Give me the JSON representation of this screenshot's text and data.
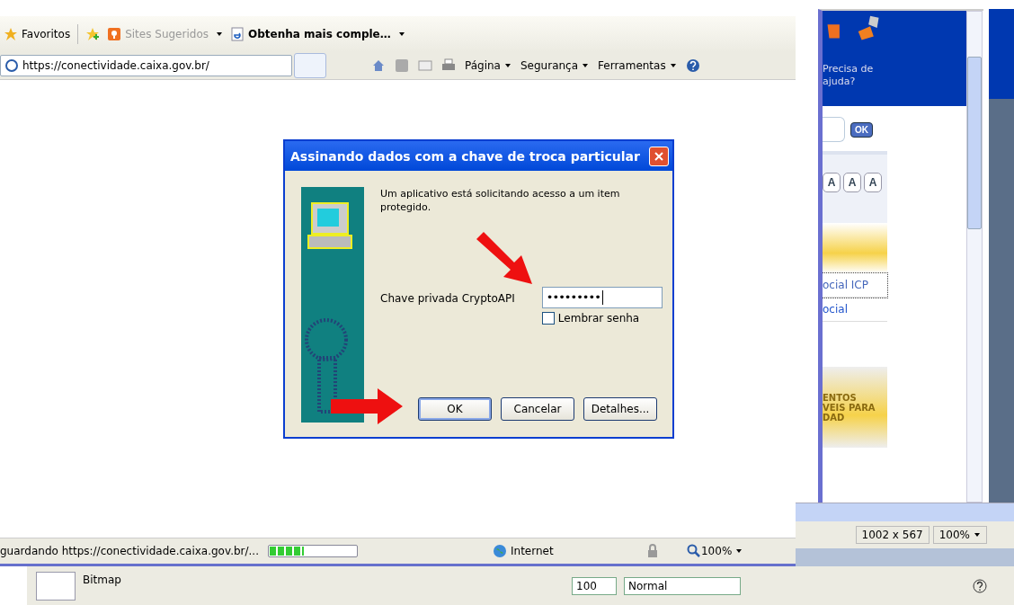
{
  "browser": {
    "favorites_bar": {
      "favorites": "Favoritos",
      "suggested_sites": "Sites Sugeridos",
      "web_slice": "Obtenha mais comple…"
    },
    "address": "https://conectividade.caixa.gov.br/",
    "command_bar": [
      "Página",
      "Segurança",
      "Ferramentas"
    ],
    "status_bar": {
      "text": "guardando https://conectividade.caixa.gov.br/...",
      "progress": {
        "level": 0.4
      },
      "zone": "Internet",
      "zoom": "100%"
    }
  },
  "side_page": {
    "help_text": "Precisa de ajuda?",
    "search_button": "OK",
    "font_buttons": [
      "A",
      "A",
      "A"
    ],
    "links": [
      {
        "label": "ocial ICP",
        "focused": true
      },
      {
        "label": "ocial",
        "focused": false
      }
    ],
    "banner_lines": [
      "ENTOS",
      "VEIS PARA",
      "DAD"
    ],
    "dimensions": "1002 x 567",
    "zoom": "100%"
  },
  "dialog": {
    "title": "Assinando dados com a chave de troca particular",
    "message": "Um aplicativo está solicitando acesso a um item protegido.",
    "password_label": "Chave privada CryptoAPI",
    "password_value": "•••••••••",
    "remember": {
      "label": "Lembrar senha",
      "checked": false
    },
    "buttons": [
      {
        "label": "OK",
        "default": true
      },
      {
        "label": "Cancelar",
        "default": false
      },
      {
        "label": "Detalhes...",
        "default": false
      }
    ]
  },
  "bottom_panel": {
    "layer": "Bitmap",
    "opacity": "100",
    "blend_mode": "Normal"
  }
}
